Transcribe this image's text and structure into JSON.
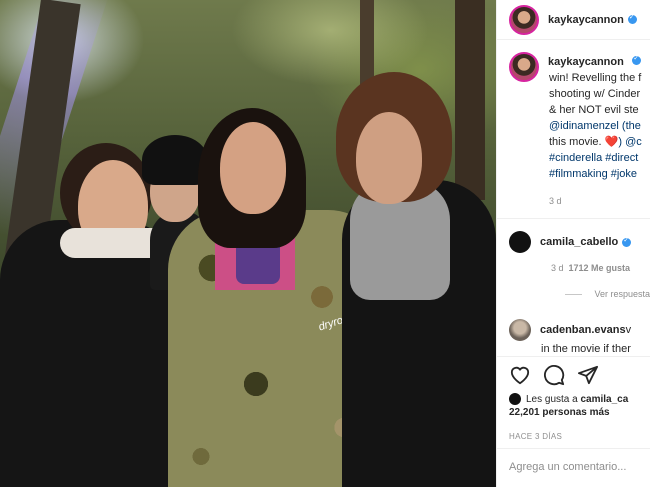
{
  "post": {
    "username": "kaykaycannon",
    "caption_lines": [
      "win! Revelling the f",
      "shooting w/ Cinder",
      "& her NOT evil ste",
      "@idinamenzel (the",
      "this movie. ",
      "#cinderella #direct",
      "#filmmaking #joke"
    ],
    "caption_line5_tail": ") @c",
    "heart_glyph": "❤️",
    "time": "3 d"
  },
  "comments": [
    {
      "username": "camila_cabello",
      "time": "3 d",
      "likes": "1712 Me gusta",
      "replies_label": "Ver respuesta"
    },
    {
      "username": "cadenban.evans",
      "text_tail": " v",
      "text_line2": "in the movie if ther"
    }
  ],
  "actions": {
    "liked_by_prefix": "Les gusta a ",
    "liked_by_user": "camila_ca",
    "liked_by_count": "22,201 personas más",
    "ago": "HACE 3 DÍAS",
    "comment_placeholder": "Agrega un comentario..."
  },
  "icons": [
    "heart-icon",
    "comment-icon",
    "share-icon",
    "verified-icon"
  ],
  "colors": {
    "verified": "#3897f0",
    "link": "#00376b",
    "muted": "#8e8e8e"
  }
}
